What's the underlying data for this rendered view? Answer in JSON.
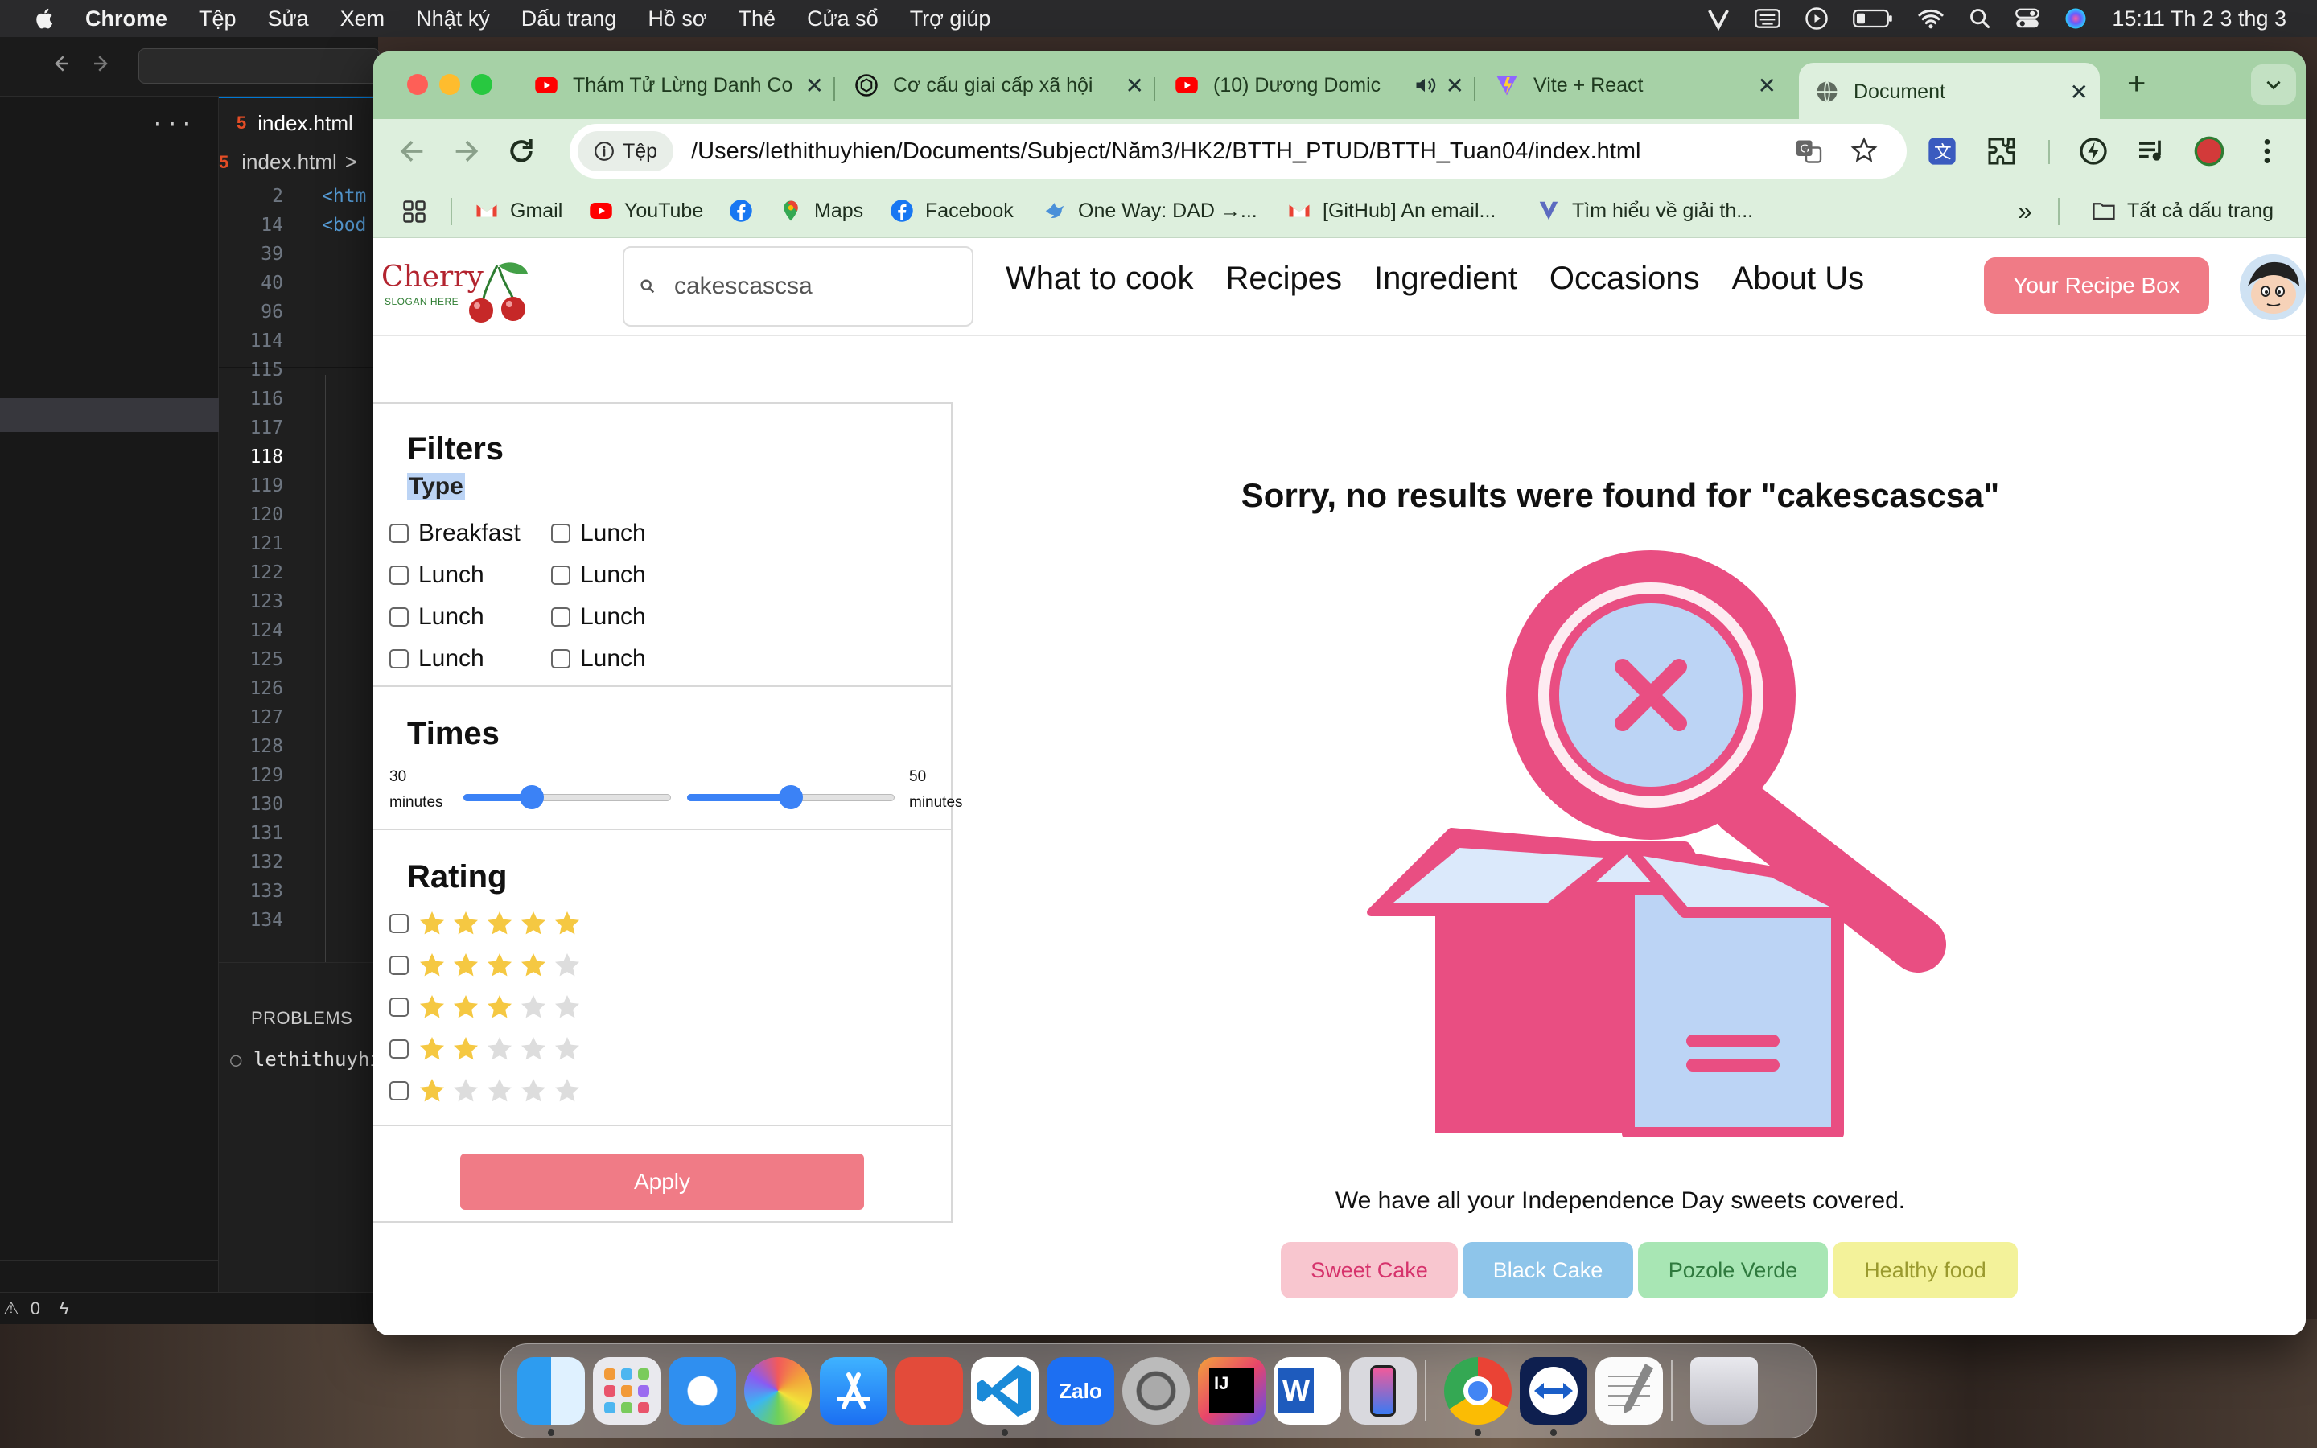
{
  "menubar": {
    "app_name": "Chrome",
    "items": [
      "Tệp",
      "Sửa",
      "Xem",
      "Nhật ký",
      "Dấu trang",
      "Hồ sơ",
      "Thẻ",
      "Cửa sổ",
      "Trợ giúp"
    ],
    "clock": "15:11 Th 2 3 thg 3",
    "status_icons": [
      "vivaldi-icon",
      "keyboard-input-icon",
      "play-circle-icon",
      "battery-icon",
      "wifi-icon",
      "spotlight-search-icon",
      "control-center-icon",
      "siri-icon"
    ]
  },
  "vscode": {
    "tab_label": "index.html",
    "breadcrumb": "index.html",
    "breadcrumb_sep": ">",
    "tab_icon_glyph": "5",
    "lines": [
      {
        "num": "2",
        "text": "<htm"
      },
      {
        "num": "14",
        "text": "<bod"
      },
      {
        "num": "39",
        "text": ""
      },
      {
        "num": "40",
        "text": ""
      },
      {
        "num": "96",
        "text": ""
      },
      {
        "num": "114",
        "text": ""
      },
      {
        "num": "115",
        "text": ""
      },
      {
        "num": "116",
        "text": ""
      },
      {
        "num": "117",
        "text": ""
      },
      {
        "num": "118",
        "text": ""
      },
      {
        "num": "119",
        "text": ""
      },
      {
        "num": "120",
        "text": ""
      },
      {
        "num": "121",
        "text": ""
      },
      {
        "num": "122",
        "text": ""
      },
      {
        "num": "123",
        "text": ""
      },
      {
        "num": "124",
        "text": ""
      },
      {
        "num": "125",
        "text": ""
      },
      {
        "num": "126",
        "text": ""
      },
      {
        "num": "127",
        "text": ""
      },
      {
        "num": "128",
        "text": ""
      },
      {
        "num": "129",
        "text": ""
      },
      {
        "num": "130",
        "text": ""
      },
      {
        "num": "131",
        "text": ""
      },
      {
        "num": "132",
        "text": ""
      },
      {
        "num": "133",
        "text": ""
      },
      {
        "num": "134",
        "text": ""
      }
    ],
    "current_line": "118",
    "panel_title": "PROBLEMS",
    "panel_line": "lethithuyhi",
    "status_problems": "0"
  },
  "chrome": {
    "tabs": [
      {
        "title": "Thám Tử Lừng Danh Co",
        "icon": "youtube-icon"
      },
      {
        "title": "Cơ cấu giai cấp xã hội",
        "icon": "chatgpt-icon"
      },
      {
        "title": "(10) Dương Domic",
        "icon": "youtube-icon"
      },
      {
        "title": "Vite + React",
        "icon": "vite-icon"
      },
      {
        "title": "Document",
        "icon": "globe-icon"
      }
    ],
    "active_tab": "Document",
    "address_chip": "Tệp",
    "url": "/Users/lethithuyhien/Documents/Subject/Năm3/HK2/BTTH_PTUD/BTTH_Tuan04/index.html",
    "bookmarks": [
      {
        "label": "Gmail",
        "icon": "gmail-icon"
      },
      {
        "label": "YouTube",
        "icon": "youtube-icon"
      },
      {
        "label": "",
        "icon": "facebook-icon"
      },
      {
        "label": "Maps",
        "icon": "maps-icon"
      },
      {
        "label": "Facebook",
        "icon": "facebook-icon"
      },
      {
        "label": "One Way: DAD →...",
        "icon": "bird-icon"
      },
      {
        "label": "[GitHub] An email...",
        "icon": "gmail-icon"
      },
      {
        "label": "Tìm hiểu về giải th...",
        "icon": "vuetify-icon"
      }
    ],
    "bookmarks_overflow": "»",
    "all_bookmarks": "Tất cả dấu trang"
  },
  "site": {
    "logo_text": "Cherry",
    "slogan": "SLOGAN HERE",
    "search_value": "cakescascsa",
    "nav": [
      "What to cook",
      "Recipes",
      "Ingredient",
      "Occasions",
      "About Us"
    ],
    "recipe_box_button": "Your Recipe Box",
    "filters": {
      "title": "Filters",
      "type_label": "Type",
      "type_options": [
        [
          "Breakfast",
          "Lunch"
        ],
        [
          "Lunch",
          "Lunch"
        ],
        [
          "Lunch",
          "Lunch"
        ],
        [
          "Lunch",
          "Lunch"
        ]
      ],
      "times_title": "Times",
      "time_min_value": "30",
      "time_max_value": "50",
      "time_unit": "minutes",
      "slider1_fraction": 0.33,
      "slider2_fraction": 0.5,
      "rating_title": "Rating",
      "rating_rows": [
        5,
        4,
        3,
        2,
        1
      ],
      "apply_button": "Apply",
      "star_color": "#f5c842",
      "star_empty_color": "#dddddd"
    },
    "no_result_message": "Sorry, no results were found for \"cakescascsa\"",
    "subtitle": "We have all your Independence Day sweets covered.",
    "tags": [
      {
        "label": "Sweet Cake",
        "bg": "#f8c6cf",
        "fg": "#d6336c"
      },
      {
        "label": "Black Cake",
        "bg": "#8ec5ea",
        "fg": "#ffffff"
      },
      {
        "label": "Pozole Verde",
        "bg": "#a8e6b4",
        "fg": "#2f7a3e"
      },
      {
        "label": "Healthy food",
        "bg": "#f3f29a",
        "fg": "#9a9a2e"
      }
    ],
    "accent_color": "#f07b86"
  },
  "dock": {
    "apps": [
      "finder-icon",
      "launchpad-icon",
      "safari-icon",
      "photos-icon",
      "app-store-icon",
      "photo-booth-icon",
      "vscode-icon",
      "zalo-icon",
      "system-settings-icon",
      "intellij-icon",
      "word-icon",
      "iphone-mirroring-icon",
      "chrome-icon",
      "teamviewer-icon",
      "textedit-icon",
      "trash-icon"
    ],
    "zalo_label": "Zalo",
    "word_label": "W",
    "intellij_label": "IJ"
  }
}
